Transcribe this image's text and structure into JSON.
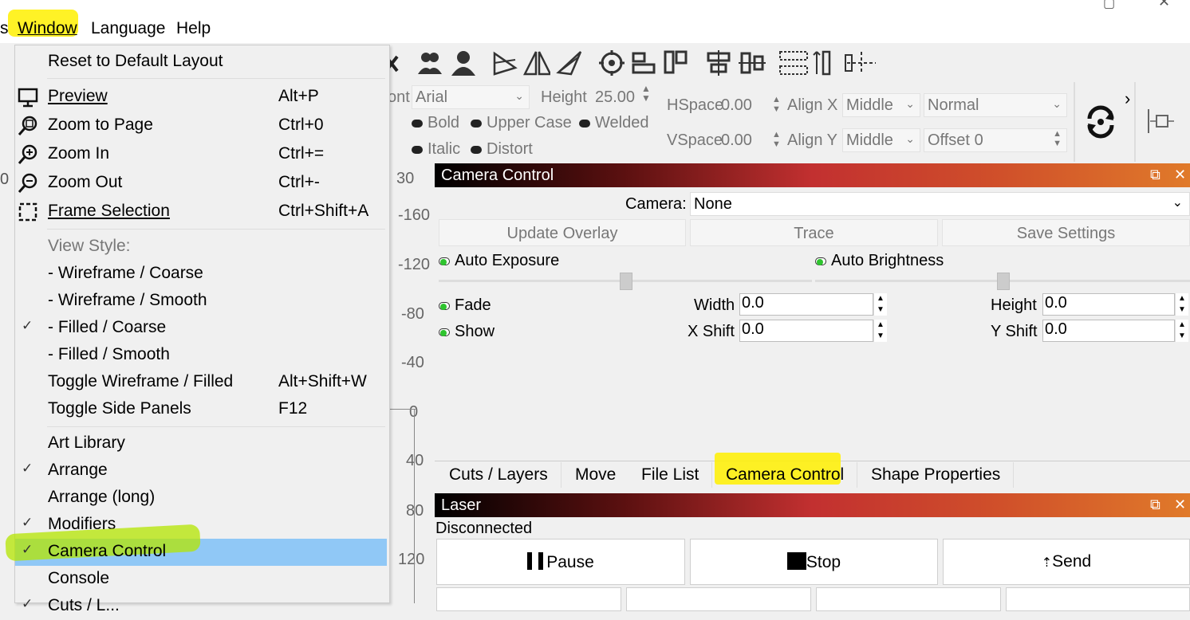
{
  "menubar": {
    "items": [
      "s",
      "Window",
      "Language",
      "Help"
    ]
  },
  "window_menu": {
    "reset": "Reset to Default Layout",
    "items": [
      {
        "label": "Preview",
        "shortcut": "Alt+P",
        "icon": "monitor-icon"
      },
      {
        "label": "Zoom to Page",
        "shortcut": "Ctrl+0",
        "icon": "zoom-page-icon"
      },
      {
        "label": "Zoom In",
        "shortcut": "Ctrl+=",
        "icon": "zoom-in-icon"
      },
      {
        "label": "Zoom Out",
        "shortcut": "Ctrl+-",
        "icon": "zoom-out-icon"
      },
      {
        "label": "Frame Selection",
        "shortcut": "Ctrl+Shift+A",
        "icon": "frame-selection-icon"
      }
    ],
    "view_style_header": "View Style:",
    "view_styles": [
      {
        "label": "-  Wireframe / Coarse",
        "checked": false
      },
      {
        "label": "-  Wireframe / Smooth",
        "checked": false
      },
      {
        "label": "-  Filled / Coarse",
        "checked": true
      },
      {
        "label": "-  Filled / Smooth",
        "checked": false
      }
    ],
    "toggle_wireframe": {
      "label": "Toggle Wireframe / Filled",
      "shortcut": "Alt+Shift+W"
    },
    "toggle_side": {
      "label": "Toggle Side Panels",
      "shortcut": "F12"
    },
    "panels": [
      {
        "label": "Art Library",
        "checked": false
      },
      {
        "label": "Arrange",
        "checked": true
      },
      {
        "label": "Arrange (long)",
        "checked": false
      },
      {
        "label": "Modifiers",
        "checked": true
      },
      {
        "label": "Camera Control",
        "checked": true,
        "highlighted": true
      },
      {
        "label": "Console",
        "checked": false
      },
      {
        "label": "Cuts / L...",
        "checked": true
      }
    ]
  },
  "text_props": {
    "font_label": "ont",
    "font_value": "Arial",
    "height_label": "Height",
    "height_value": "25.00",
    "bold": "Bold",
    "upper_case": "Upper Case",
    "welded": "Welded",
    "italic": "Italic",
    "distort": "Distort",
    "hspace_label": "HSpace",
    "hspace_value": "0.00",
    "vspace_label": "VSpace",
    "vspace_value": "0.00",
    "alignx_label": "Align X",
    "alignx_value": "Middle",
    "aligny_label": "Align Y",
    "aligny_value": "Middle",
    "normal_value": "Normal",
    "offset_label": "Offset",
    "offset_value": "0"
  },
  "ruler": {
    "labels": [
      "30",
      "-160",
      "-120",
      "-80",
      "-40",
      "0",
      "40",
      "80",
      "120"
    ]
  },
  "left_ruler": {
    "labels": [
      "0"
    ]
  },
  "camera_panel": {
    "title": "Camera Control",
    "camera_label": "Camera:",
    "camera_value": "None",
    "update_overlay": "Update Overlay",
    "trace": "Trace",
    "save_settings": "Save Settings",
    "auto_exposure": "Auto Exposure",
    "auto_brightness": "Auto Brightness",
    "fade": "Fade",
    "show": "Show",
    "width_label": "Width",
    "width_value": "0.0",
    "height_label": "Height",
    "height_value": "0.0",
    "xshift_label": "X Shift",
    "xshift_value": "0.0",
    "yshift_label": "Y Shift",
    "yshift_value": "0.0"
  },
  "tabs": [
    "Cuts / Layers",
    "Move",
    "File List",
    "Camera Control",
    "Shape Properties"
  ],
  "laser_panel": {
    "title": "Laser",
    "status": "Disconnected",
    "pause": "Pause",
    "stop": "Stop",
    "send": "Send"
  },
  "colors": {
    "highlight": "#fff000",
    "selection": "#90c8f6",
    "led_green": "#2ec42e"
  }
}
